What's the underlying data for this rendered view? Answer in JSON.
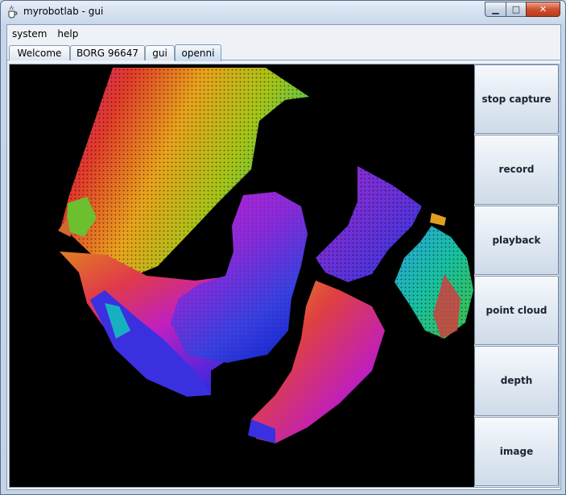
{
  "window": {
    "title": "myrobotlab - gui",
    "minimize_glyph": "▁",
    "maximize_glyph": "□",
    "close_glyph": "✕"
  },
  "menu": {
    "items": [
      {
        "label": "system"
      },
      {
        "label": "help"
      }
    ]
  },
  "tabs": [
    {
      "label": "Welcome",
      "active": false
    },
    {
      "label": "BORG 96647",
      "active": false
    },
    {
      "label": "gui",
      "active": false
    },
    {
      "label": "openni",
      "active": true
    }
  ],
  "controls": {
    "buttons": [
      {
        "label": "stop capture"
      },
      {
        "label": "record"
      },
      {
        "label": "playback"
      },
      {
        "label": "point cloud"
      },
      {
        "label": "depth"
      },
      {
        "label": "image"
      }
    ]
  },
  "icons": {
    "app": "java-cup-icon",
    "minimize": "minimize-icon",
    "maximize": "maximize-icon",
    "close": "close-icon"
  },
  "colors": {
    "viewport_background": "#000000",
    "close_button": "#c8462a"
  }
}
